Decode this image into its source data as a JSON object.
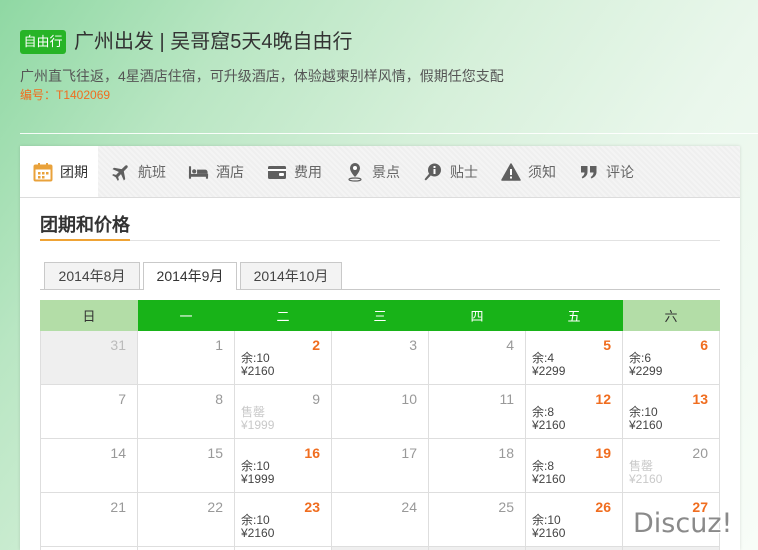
{
  "colors": {
    "badge_bg": "#27b427",
    "weekday_header_bg": "#18b318",
    "weekend_header_bg": "#b3dda7",
    "accent_orange": "#f06d1f",
    "active_tab_icon": "#e9a23b"
  },
  "header": {
    "badge": "自由行",
    "title": "广州出发 | 吴哥窟5天4晚自由行",
    "subtitle": "广州直飞往返，4星酒店住宿，可升级酒店，体验越柬别样风情，假期任您支配",
    "code": "编号：T1402069"
  },
  "tabs": [
    {
      "label": "团期",
      "icon": "calendar-icon",
      "active": true
    },
    {
      "label": "航班",
      "icon": "airplane-icon"
    },
    {
      "label": "酒店",
      "icon": "bed-icon"
    },
    {
      "label": "费用",
      "icon": "wallet-icon"
    },
    {
      "label": "景点",
      "icon": "map-pin-icon"
    },
    {
      "label": "贴士",
      "icon": "tips-icon"
    },
    {
      "label": "须知",
      "icon": "warning-icon"
    },
    {
      "label": "评论",
      "icon": "quote-icon"
    }
  ],
  "section_title": "团期和价格",
  "months": [
    {
      "label": "2014年8月"
    },
    {
      "label": "2014年9月",
      "active": true
    },
    {
      "label": "2014年10月"
    }
  ],
  "calendar": {
    "weekdays": [
      "日",
      "一",
      "二",
      "三",
      "四",
      "五",
      "六"
    ],
    "weeks": [
      [
        {
          "day": "31",
          "other_month": true
        },
        {
          "day": "1"
        },
        {
          "day": "2",
          "available": true,
          "remaining": "余:10",
          "price": "¥2160"
        },
        {
          "day": "3"
        },
        {
          "day": "4"
        },
        {
          "day": "5",
          "available": true,
          "remaining": "余:4",
          "price": "¥2299"
        },
        {
          "day": "6",
          "available": true,
          "remaining": "余:6",
          "price": "¥2299"
        }
      ],
      [
        {
          "day": "7"
        },
        {
          "day": "8"
        },
        {
          "day": "9",
          "sold_out": true,
          "remaining": "售罄",
          "price": "¥1999"
        },
        {
          "day": "10"
        },
        {
          "day": "11"
        },
        {
          "day": "12",
          "available": true,
          "remaining": "余:8",
          "price": "¥2160"
        },
        {
          "day": "13",
          "available": true,
          "remaining": "余:10",
          "price": "¥2160"
        }
      ],
      [
        {
          "day": "14"
        },
        {
          "day": "15"
        },
        {
          "day": "16",
          "available": true,
          "remaining": "余:10",
          "price": "¥1999"
        },
        {
          "day": "17"
        },
        {
          "day": "18"
        },
        {
          "day": "19",
          "available": true,
          "remaining": "余:8",
          "price": "¥2160"
        },
        {
          "day": "20",
          "sold_out": true,
          "remaining": "售罄",
          "price": "¥2160"
        }
      ],
      [
        {
          "day": "21"
        },
        {
          "day": "22"
        },
        {
          "day": "23",
          "available": true,
          "remaining": "余:10",
          "price": "¥2160"
        },
        {
          "day": "24"
        },
        {
          "day": "25"
        },
        {
          "day": "26",
          "available": true,
          "remaining": "余:10",
          "price": "¥2160"
        },
        {
          "day": "27",
          "available": true
        }
      ]
    ]
  },
  "watermark": "Discuz!"
}
